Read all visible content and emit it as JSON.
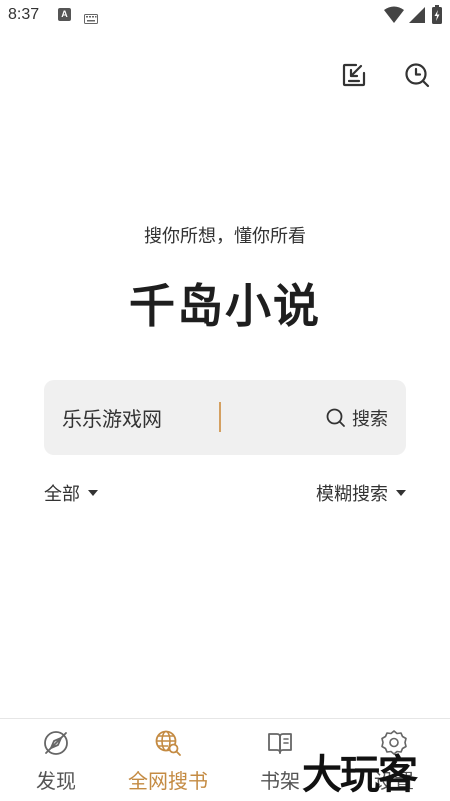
{
  "status_bar": {
    "time": "8:37",
    "notification_glyph": "A"
  },
  "top_actions": {
    "download_icon": "download-icon",
    "history_icon": "history-icon"
  },
  "hero": {
    "slogan": "搜你所想，懂你所看",
    "title": "千岛小说"
  },
  "search": {
    "value": "乐乐游戏网",
    "button_label": "搜索"
  },
  "filters": {
    "scope_selected": "全部",
    "mode_selected": "模糊搜索"
  },
  "bottom_nav": {
    "items": [
      {
        "label": "发现",
        "icon": "compass-icon",
        "active": false
      },
      {
        "label": "全网搜书",
        "icon": "globe-search-icon",
        "active": true
      },
      {
        "label": "书架",
        "icon": "book-icon",
        "active": false
      },
      {
        "label": "设置",
        "icon": "gear-icon",
        "active": false
      }
    ]
  },
  "watermark": "大玩客",
  "colors": {
    "accent": "#c48b43",
    "search_bg": "#f0f0f0",
    "text": "#222222"
  }
}
